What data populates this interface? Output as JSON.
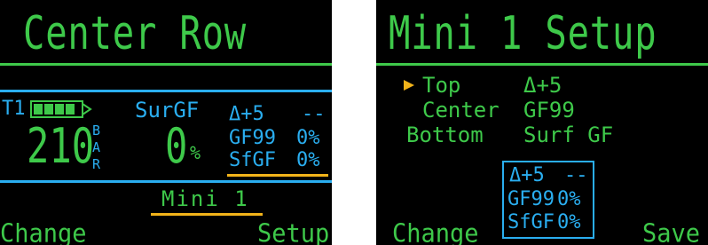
{
  "left": {
    "title": "Center Row",
    "tank_label": "T1",
    "pressure": "210",
    "pressure_unit": "BAR",
    "surgf_label": "SurGF",
    "surgf_value": "0",
    "surgf_unit": "%",
    "delta_label": "Δ+5",
    "delta_value": "--",
    "gf99_label": "GF99",
    "gf99_value": "0%",
    "sfgf_label": "SfGF",
    "sfgf_value": "0%",
    "mini_label": "Mini 1",
    "softkey_left": "Change",
    "softkey_right": "Setup"
  },
  "right": {
    "title": "Mini 1 Setup",
    "menu": [
      {
        "label": "Top",
        "value": "Δ+5"
      },
      {
        "label": "Center",
        "value": "GF99"
      },
      {
        "label": "Bottom",
        "value": "Surf GF"
      }
    ],
    "preview": {
      "delta_label": "Δ+5",
      "delta_value": "--",
      "gf99_label": "GF99",
      "gf99_value": "0%",
      "sfgf_label": "SfGF",
      "sfgf_value": "0%"
    },
    "softkey_left": "Change",
    "softkey_right": "Save"
  },
  "colors": {
    "green": "#3ec94a",
    "blue": "#2aaef0",
    "yellow": "#f2b31a",
    "background": "#000000"
  },
  "icons": {
    "battery": "battery-icon",
    "cursor": "selection-arrow-icon"
  }
}
